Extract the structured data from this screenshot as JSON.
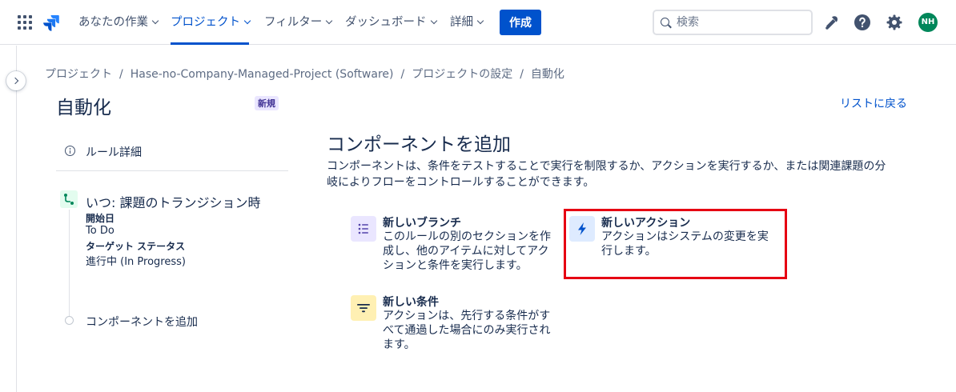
{
  "nav": {
    "items": [
      {
        "label": "あなたの作業",
        "active": false
      },
      {
        "label": "プロジェクト",
        "active": true
      },
      {
        "label": "フィルター",
        "active": false
      },
      {
        "label": "ダッシュボード",
        "active": false
      },
      {
        "label": "詳細",
        "active": false
      }
    ],
    "create_label": "作成",
    "search_placeholder": "検索",
    "avatar_initials": "NH"
  },
  "breadcrumb": {
    "items": [
      "プロジェクト",
      "Hase-no-Company-Managed-Project (Software)",
      "プロジェクトの設定",
      "自動化"
    ],
    "separator": "/"
  },
  "page": {
    "title": "自動化",
    "badge": "新規",
    "back_link": "リストに戻る"
  },
  "rule": {
    "details_label": "ルール詳細",
    "trigger_title": "いつ: 課題のトランジション時",
    "from_label": "開始日",
    "from_value": "To Do",
    "to_label": "ターゲット ステータス",
    "to_value": "進行中 (In Progress)",
    "add_component": "コンポーネントを追加"
  },
  "panel": {
    "title": "コンポーネントを追加",
    "description": "コンポーネントは、条件をテストすることで実行を制限するか、アクションを実行するか、または関連課題の分岐によりフローをコントロールすることができます。",
    "cards": [
      {
        "title": "新しいブランチ",
        "description": "このルールの別のセクションを作成し、他のアイテムに対してアクションと条件を実行します。",
        "icon": "branch-icon",
        "color": "#eae6ff"
      },
      {
        "title": "新しいアクション",
        "description": "アクションはシステムの変更を実行します。",
        "icon": "lightning-icon",
        "color": "#deebff"
      },
      {
        "title": "新しい条件",
        "description": "アクションは、先行する条件がすべて通過した場合にのみ実行されます。",
        "icon": "filter-icon",
        "color": "#fff0b3"
      }
    ]
  },
  "colors": {
    "primary": "#0052cc",
    "highlight": "#e60012"
  }
}
